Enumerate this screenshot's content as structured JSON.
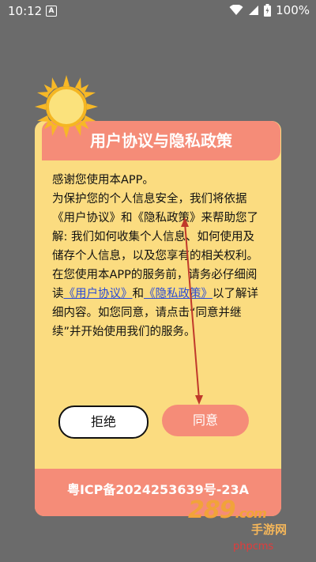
{
  "status_bar": {
    "time": "10:12",
    "notification_icon_letter": "A",
    "battery_text": "100%"
  },
  "dialog": {
    "title": "用户协议与隐私政策",
    "paragraph1": "感谢您使用本APP。",
    "paragraph2": "为保护您的个人信息安全，我们将依据《用户协议》和《隐私政策》来帮助您了解: 我们如何收集个人信息、如何使用及储存个人信息，以及您享有的相关权利。",
    "paragraph3_prefix": "在您使用本APP的服务前，请务必仔细阅读",
    "link_user_agreement": "《用户协议》",
    "and_text": "和",
    "link_privacy_policy": "《隐私政策》",
    "paragraph3_suffix": "以了解详细内容。如您同意，请点击“同意并继续”并开始使用我们的服务。",
    "reject_label": "拒绝",
    "agree_label": "同意",
    "footer": "粤ICP备2024253639号-23A"
  },
  "watermarks": {
    "brand": "289",
    "dotcom": ".com",
    "site": "手游网",
    "phpcms": "phpcms"
  },
  "colors": {
    "background": "#6b6b6b",
    "card": "#fbdc80",
    "accent": "#f58c78",
    "link": "#2b4bd6",
    "annotation": "#c0392b"
  }
}
